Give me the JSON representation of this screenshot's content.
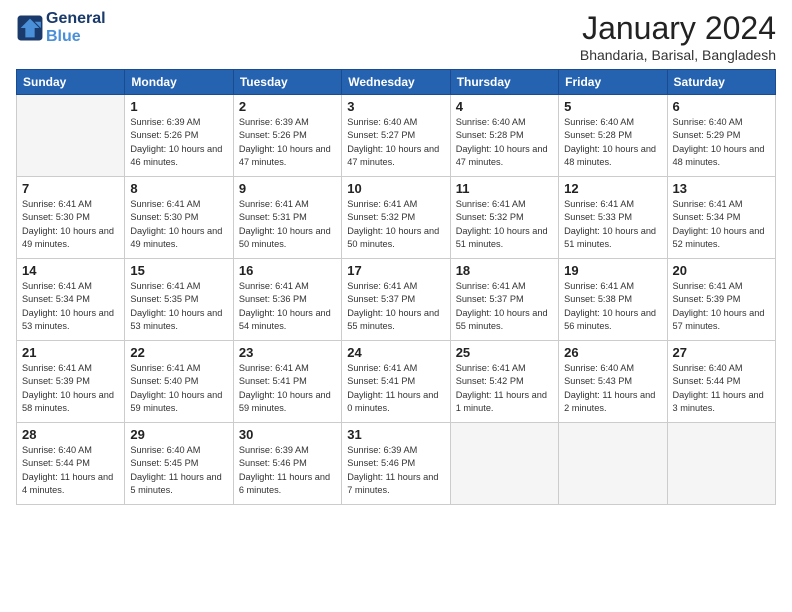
{
  "header": {
    "logo_line1": "General",
    "logo_line2": "Blue",
    "month_title": "January 2024",
    "location": "Bhandaria, Barisal, Bangladesh"
  },
  "days_of_week": [
    "Sunday",
    "Monday",
    "Tuesday",
    "Wednesday",
    "Thursday",
    "Friday",
    "Saturday"
  ],
  "weeks": [
    [
      {
        "day": "",
        "empty": true
      },
      {
        "day": "1",
        "sunrise": "6:39 AM",
        "sunset": "5:26 PM",
        "daylight": "10 hours and 46 minutes."
      },
      {
        "day": "2",
        "sunrise": "6:39 AM",
        "sunset": "5:26 PM",
        "daylight": "10 hours and 47 minutes."
      },
      {
        "day": "3",
        "sunrise": "6:40 AM",
        "sunset": "5:27 PM",
        "daylight": "10 hours and 47 minutes."
      },
      {
        "day": "4",
        "sunrise": "6:40 AM",
        "sunset": "5:28 PM",
        "daylight": "10 hours and 47 minutes."
      },
      {
        "day": "5",
        "sunrise": "6:40 AM",
        "sunset": "5:28 PM",
        "daylight": "10 hours and 48 minutes."
      },
      {
        "day": "6",
        "sunrise": "6:40 AM",
        "sunset": "5:29 PM",
        "daylight": "10 hours and 48 minutes."
      }
    ],
    [
      {
        "day": "7",
        "sunrise": "6:41 AM",
        "sunset": "5:30 PM",
        "daylight": "10 hours and 49 minutes."
      },
      {
        "day": "8",
        "sunrise": "6:41 AM",
        "sunset": "5:30 PM",
        "daylight": "10 hours and 49 minutes."
      },
      {
        "day": "9",
        "sunrise": "6:41 AM",
        "sunset": "5:31 PM",
        "daylight": "10 hours and 50 minutes."
      },
      {
        "day": "10",
        "sunrise": "6:41 AM",
        "sunset": "5:32 PM",
        "daylight": "10 hours and 50 minutes."
      },
      {
        "day": "11",
        "sunrise": "6:41 AM",
        "sunset": "5:32 PM",
        "daylight": "10 hours and 51 minutes."
      },
      {
        "day": "12",
        "sunrise": "6:41 AM",
        "sunset": "5:33 PM",
        "daylight": "10 hours and 51 minutes."
      },
      {
        "day": "13",
        "sunrise": "6:41 AM",
        "sunset": "5:34 PM",
        "daylight": "10 hours and 52 minutes."
      }
    ],
    [
      {
        "day": "14",
        "sunrise": "6:41 AM",
        "sunset": "5:34 PM",
        "daylight": "10 hours and 53 minutes."
      },
      {
        "day": "15",
        "sunrise": "6:41 AM",
        "sunset": "5:35 PM",
        "daylight": "10 hours and 53 minutes."
      },
      {
        "day": "16",
        "sunrise": "6:41 AM",
        "sunset": "5:36 PM",
        "daylight": "10 hours and 54 minutes."
      },
      {
        "day": "17",
        "sunrise": "6:41 AM",
        "sunset": "5:37 PM",
        "daylight": "10 hours and 55 minutes."
      },
      {
        "day": "18",
        "sunrise": "6:41 AM",
        "sunset": "5:37 PM",
        "daylight": "10 hours and 55 minutes."
      },
      {
        "day": "19",
        "sunrise": "6:41 AM",
        "sunset": "5:38 PM",
        "daylight": "10 hours and 56 minutes."
      },
      {
        "day": "20",
        "sunrise": "6:41 AM",
        "sunset": "5:39 PM",
        "daylight": "10 hours and 57 minutes."
      }
    ],
    [
      {
        "day": "21",
        "sunrise": "6:41 AM",
        "sunset": "5:39 PM",
        "daylight": "10 hours and 58 minutes."
      },
      {
        "day": "22",
        "sunrise": "6:41 AM",
        "sunset": "5:40 PM",
        "daylight": "10 hours and 59 minutes."
      },
      {
        "day": "23",
        "sunrise": "6:41 AM",
        "sunset": "5:41 PM",
        "daylight": "10 hours and 59 minutes."
      },
      {
        "day": "24",
        "sunrise": "6:41 AM",
        "sunset": "5:41 PM",
        "daylight": "11 hours and 0 minutes."
      },
      {
        "day": "25",
        "sunrise": "6:41 AM",
        "sunset": "5:42 PM",
        "daylight": "11 hours and 1 minute."
      },
      {
        "day": "26",
        "sunrise": "6:40 AM",
        "sunset": "5:43 PM",
        "daylight": "11 hours and 2 minutes."
      },
      {
        "day": "27",
        "sunrise": "6:40 AM",
        "sunset": "5:44 PM",
        "daylight": "11 hours and 3 minutes."
      }
    ],
    [
      {
        "day": "28",
        "sunrise": "6:40 AM",
        "sunset": "5:44 PM",
        "daylight": "11 hours and 4 minutes."
      },
      {
        "day": "29",
        "sunrise": "6:40 AM",
        "sunset": "5:45 PM",
        "daylight": "11 hours and 5 minutes."
      },
      {
        "day": "30",
        "sunrise": "6:39 AM",
        "sunset": "5:46 PM",
        "daylight": "11 hours and 6 minutes."
      },
      {
        "day": "31",
        "sunrise": "6:39 AM",
        "sunset": "5:46 PM",
        "daylight": "11 hours and 7 minutes."
      },
      {
        "day": "",
        "empty": true
      },
      {
        "day": "",
        "empty": true
      },
      {
        "day": "",
        "empty": true
      }
    ]
  ]
}
